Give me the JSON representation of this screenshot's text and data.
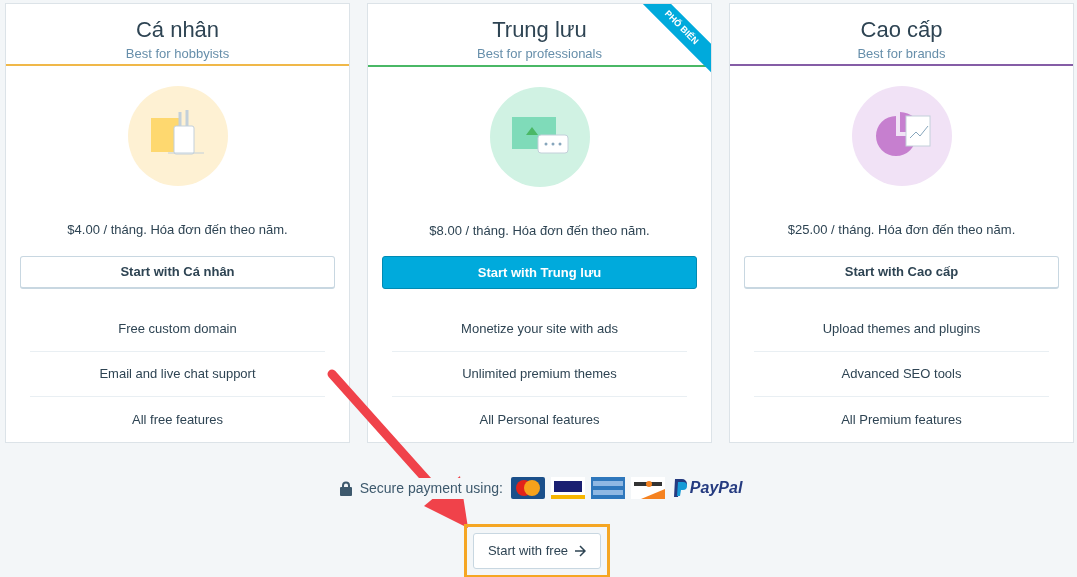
{
  "plans": [
    {
      "title": "Cá nhân",
      "subtitle": "Best for hobbyists",
      "color": "#f0b849",
      "kind": "cup",
      "price": "$4.00 / tháng. Hóa đơn đến theo năm.",
      "button": "Start with Cá nhân",
      "primary": false,
      "features": [
        "Free custom domain",
        "Email and live chat support",
        "All free features"
      ]
    },
    {
      "title": "Trung lưu",
      "subtitle": "Best for professionals",
      "color": "#4ab866",
      "kind": "chat",
      "price": "$8.00 / tháng. Hóa đơn đến theo năm.",
      "button": "Start with Trung lưu",
      "primary": true,
      "ribbon": "PHỔ BIẾN",
      "features": [
        "Monetize your site with ads",
        "Unlimited premium themes",
        "All Personal features"
      ]
    },
    {
      "title": "Cao cấp",
      "subtitle": "Best for brands",
      "color": "#855da6",
      "kind": "chart",
      "price": "$25.00 / tháng. Hóa đơn đến theo năm.",
      "button": "Start with Cao cấp",
      "primary": false,
      "features": [
        "Upload themes and plugins",
        "Advanced SEO tools",
        "All Premium features"
      ]
    }
  ],
  "payment": {
    "label": "Secure payment using:",
    "paypal": "PayPal"
  },
  "free_button": {
    "label": "Start with free",
    "highlighted": true
  }
}
